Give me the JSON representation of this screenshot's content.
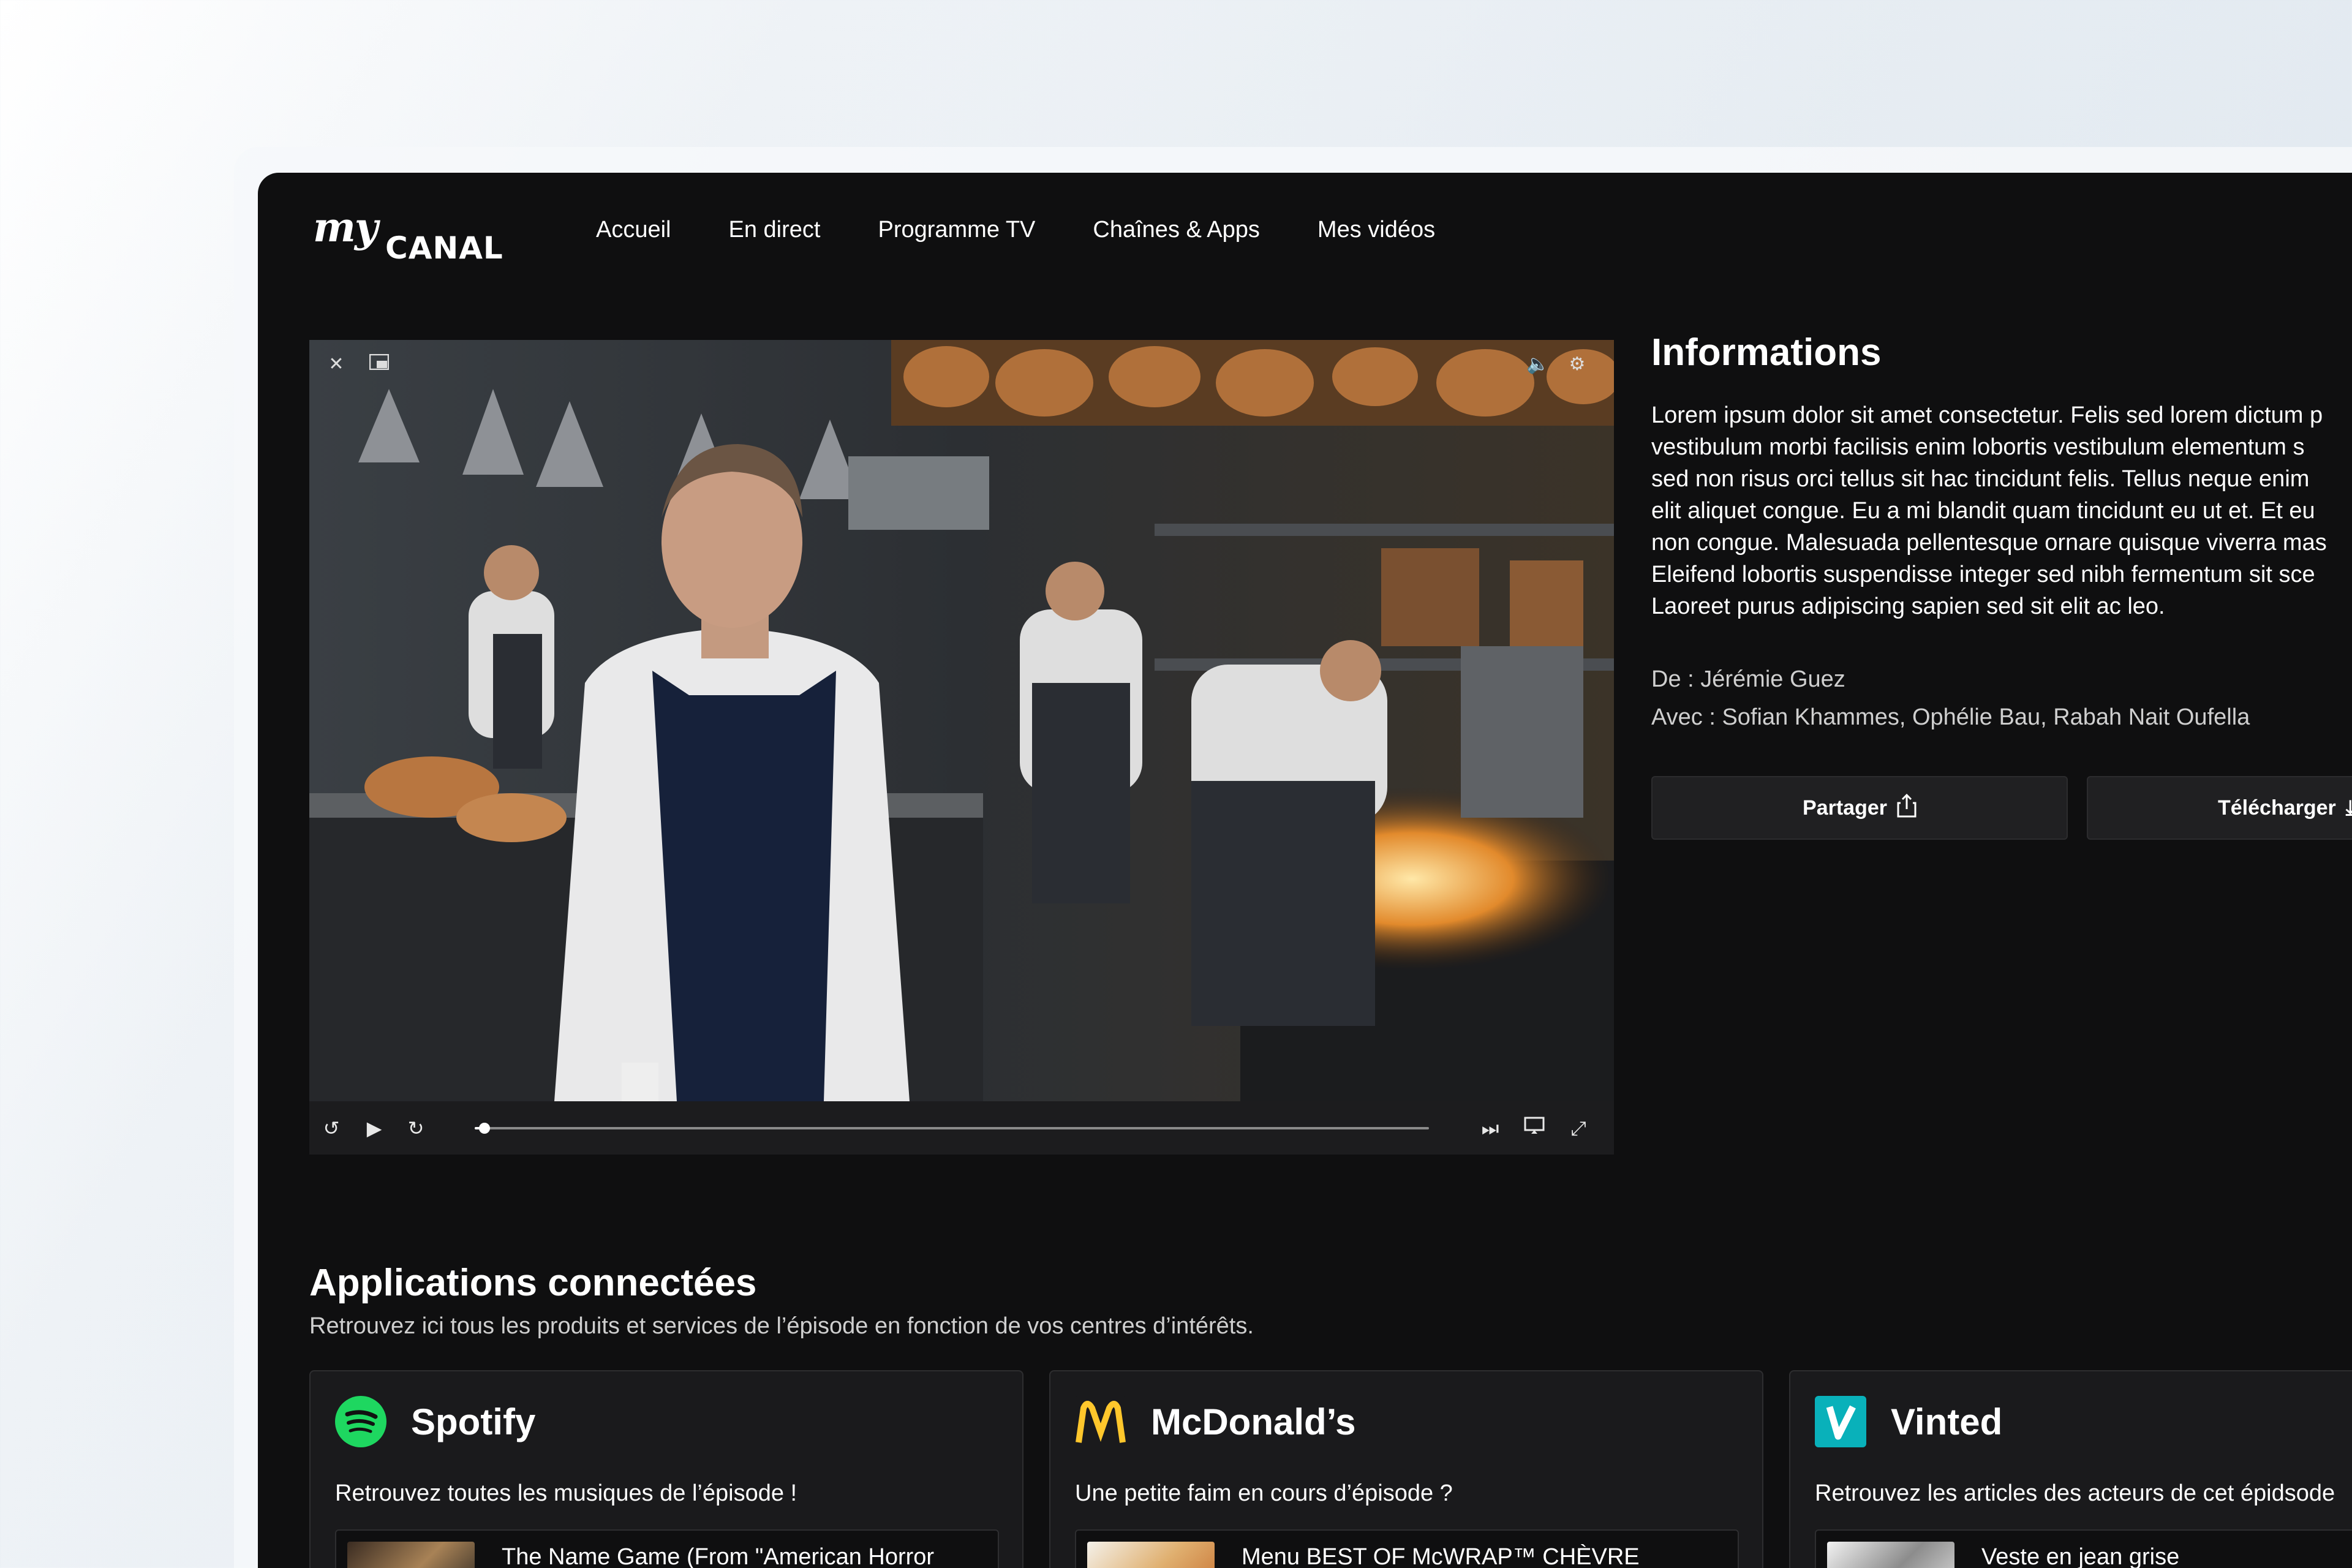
{
  "logo": {
    "my": "my",
    "canal": "CANAL"
  },
  "nav": [
    "Accueil",
    "En direct",
    "Programme TV",
    "Chaînes & Apps",
    "Mes vidéos"
  ],
  "player": {
    "progress": 0.01,
    "icons": [
      "close-icon",
      "picture-in-picture-icon",
      "volume-icon",
      "settings-icon",
      "rewind-10-icon",
      "play-icon",
      "forward-10-icon",
      "next-episode-icon",
      "cast-icon",
      "fullscreen-icon"
    ]
  },
  "info": {
    "title": "Informations",
    "description": [
      "Lorem ipsum dolor sit amet consectetur. Felis sed lorem dictum p",
      "vestibulum morbi facilisis enim lobortis vestibulum elementum s",
      "sed non risus orci tellus sit hac tincidunt felis. Tellus neque enim",
      "elit aliquet congue. Eu a mi blandit quam tincidunt eu ut et. Et eu",
      "non congue. Malesuada pellentesque ornare quisque viverra mas",
      "Eleifend lobortis suspendisse integer sed nibh fermentum sit sce",
      "Laoreet purus adipiscing sapien sed sit elit ac leo."
    ],
    "director": "De : Jérémie Guez",
    "cast": "Avec : Sofian Khammes, Ophélie Bau, Rabah Nait Oufella",
    "share_label": "Partager",
    "download_label": "Télécharger"
  },
  "apps": {
    "title": "Applications connectées",
    "subtitle": "Retrouvez ici tous les produits et services de l’épisode en fonction de vos centres d’intérêts.",
    "cards": [
      {
        "name": "Spotify",
        "desc": "Retrouvez toutes les musiques de l’épisode !",
        "item": "The Name Game (From \"American Horror",
        "color": "#1ed760"
      },
      {
        "name": "McDonald’s",
        "desc": "Une petite faim en cours d’épisode ?",
        "item": "Menu BEST OF McWRAP™ CHÈVRE",
        "color": "#ffc72c"
      },
      {
        "name": "Vinted",
        "desc": "Retrouvez les articles des acteurs de cet épidsode",
        "item": "Veste en jean grise",
        "color": "#09b1ba"
      }
    ]
  },
  "colors": {
    "background": "#0f0f10",
    "card": "#1a1a1c",
    "accent": "#ffffff"
  }
}
